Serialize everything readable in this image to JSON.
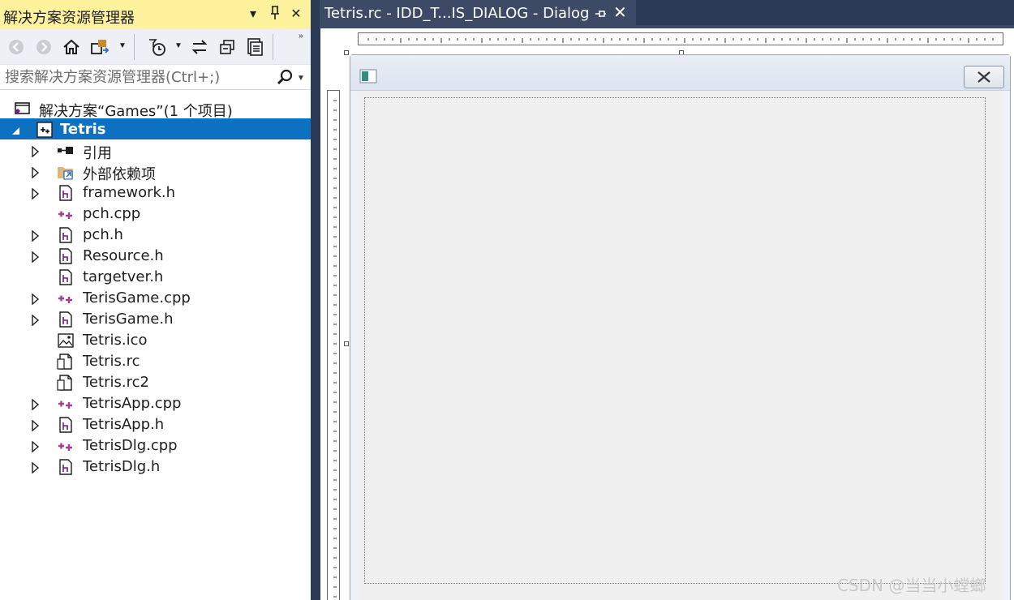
{
  "solution_explorer": {
    "title": "解决方案资源管理器",
    "title_buttons": {
      "dropdown": "▾",
      "pin": "⊓",
      "close": "✕"
    },
    "search_placeholder": "搜索解决方案资源管理器(Ctrl+;)",
    "toolbar_icons": [
      "back-icon",
      "forward-icon",
      "home-icon",
      "switch-views-icon",
      "pending-changes-filter-icon",
      "sync-icon",
      "collapse-all-icon",
      "show-all-files-icon"
    ],
    "tree": {
      "solution_label": "解决方案“Games”(1 个项目)",
      "project_label": "Tetris",
      "items": [
        {
          "label": "引用",
          "icon": "references-icon",
          "expandable": true
        },
        {
          "label": "外部依赖项",
          "icon": "external-dependencies-icon",
          "expandable": true
        },
        {
          "label": "framework.h",
          "icon": "header-file-icon",
          "expandable": true
        },
        {
          "label": "pch.cpp",
          "icon": "cpp-file-icon",
          "expandable": false
        },
        {
          "label": "pch.h",
          "icon": "header-file-icon",
          "expandable": true
        },
        {
          "label": "Resource.h",
          "icon": "header-file-icon",
          "expandable": true
        },
        {
          "label": "targetver.h",
          "icon": "header-file-icon",
          "expandable": false
        },
        {
          "label": "TerisGame.cpp",
          "icon": "cpp-file-icon",
          "expandable": true
        },
        {
          "label": "TerisGame.h",
          "icon": "header-file-icon",
          "expandable": true
        },
        {
          "label": "Tetris.ico",
          "icon": "image-file-icon",
          "expandable": false
        },
        {
          "label": "Tetris.rc",
          "icon": "resource-file-icon",
          "expandable": false
        },
        {
          "label": "Tetris.rc2",
          "icon": "resource-file-icon",
          "expandable": false
        },
        {
          "label": "TetrisApp.cpp",
          "icon": "cpp-file-icon",
          "expandable": true
        },
        {
          "label": "TetrisApp.h",
          "icon": "header-file-icon",
          "expandable": true
        },
        {
          "label": "TetrisDlg.cpp",
          "icon": "cpp-file-icon",
          "expandable": true
        },
        {
          "label": "TetrisDlg.h",
          "icon": "header-file-icon",
          "expandable": true
        }
      ]
    }
  },
  "document_tab": {
    "title": "Tetris.rc - IDD_T...IS_DIALOG - Dialog",
    "pin": "⊓",
    "close": "✕"
  },
  "watermark": "CSDN @当当小螳螂",
  "colors": {
    "title_active": "#fff29d",
    "selection": "#0e70c0",
    "ide_frame": "#2b3a55",
    "cpp_icon": "#a2408f"
  }
}
